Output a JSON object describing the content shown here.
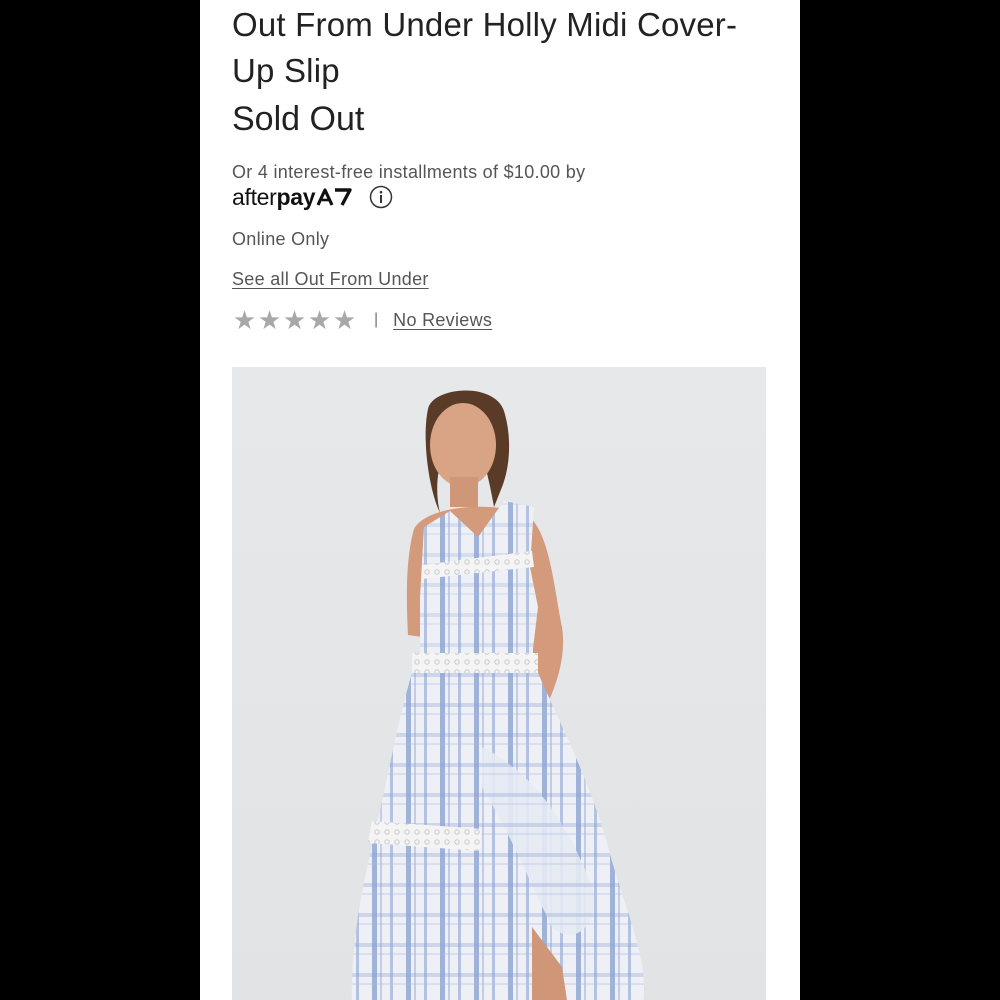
{
  "product": {
    "title": "Out From Under Holly Midi Cover-Up Slip",
    "status": "Sold Out",
    "installments_text": "Or 4 interest-free installments of $10.00 by",
    "afterpay": {
      "brand_light": "after",
      "brand_bold": "pay",
      "logo_icon": "afterpay-logo-icon",
      "info_icon": "info-icon"
    },
    "availability": "Online Only",
    "brand_link": "See all Out From Under",
    "rating": {
      "stars": 0,
      "max_stars": 5,
      "star_icon": "star-icon",
      "separator": "|",
      "reviews_link": "No Reviews"
    },
    "image": {
      "subject": "product-photo-model-in-striped-dress"
    }
  },
  "colors": {
    "page_background": "#000000",
    "panel_background": "#ffffff",
    "text_primary": "#222222",
    "text_secondary": "#555555",
    "star_empty": "#a8a8a8",
    "photo_background": "#e3e5e7",
    "dress_stripe": "#7f97c8"
  }
}
